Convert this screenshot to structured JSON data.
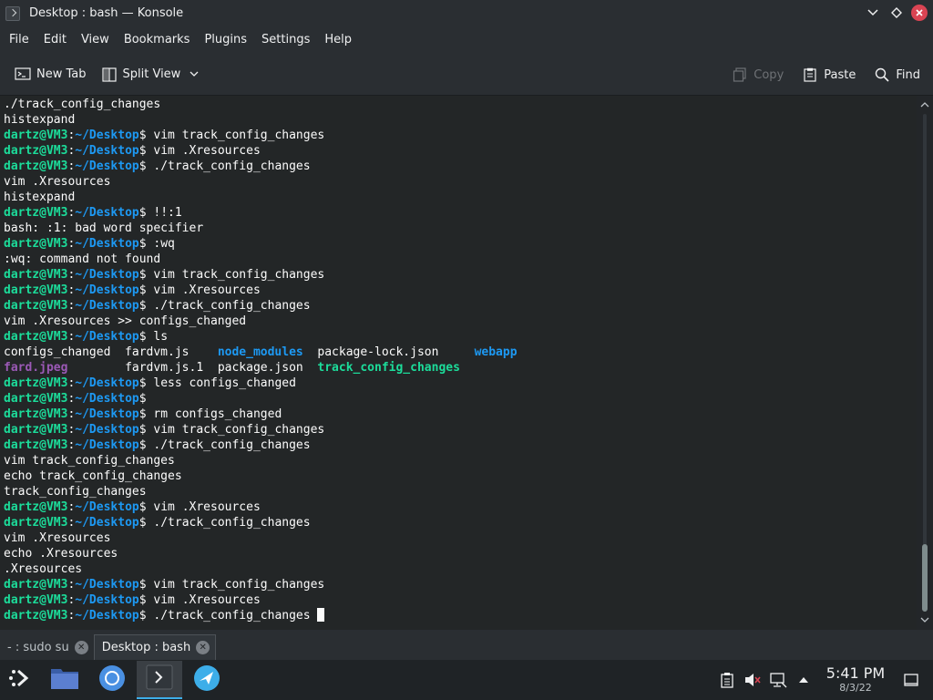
{
  "window": {
    "title": "Desktop : bash — Konsole"
  },
  "menubar": [
    "File",
    "Edit",
    "View",
    "Bookmarks",
    "Plugins",
    "Settings",
    "Help"
  ],
  "toolbar": {
    "new_tab": "New Tab",
    "split_view": "Split View",
    "copy": "Copy",
    "paste": "Paste",
    "find": "Find"
  },
  "terminal": {
    "lines": [
      [
        {
          "t": "./track_config_changes"
        }
      ],
      [
        {
          "t": "histexpand"
        }
      ],
      [
        {
          "t": "dartz@VM3",
          "c": "user"
        },
        {
          "t": ":"
        },
        {
          "t": "~/Desktop",
          "c": "path"
        },
        {
          "t": "$ vim track_config_changes"
        }
      ],
      [
        {
          "t": "dartz@VM3",
          "c": "user"
        },
        {
          "t": ":"
        },
        {
          "t": "~/Desktop",
          "c": "path"
        },
        {
          "t": "$ vim .Xresources"
        }
      ],
      [
        {
          "t": "dartz@VM3",
          "c": "user"
        },
        {
          "t": ":"
        },
        {
          "t": "~/Desktop",
          "c": "path"
        },
        {
          "t": "$ ./track_config_changes"
        }
      ],
      [
        {
          "t": "vim .Xresources"
        }
      ],
      [
        {
          "t": "histexpand"
        }
      ],
      [
        {
          "t": "dartz@VM3",
          "c": "user"
        },
        {
          "t": ":"
        },
        {
          "t": "~/Desktop",
          "c": "path"
        },
        {
          "t": "$ !!:1"
        }
      ],
      [
        {
          "t": "bash: :1: bad word specifier"
        }
      ],
      [
        {
          "t": "dartz@VM3",
          "c": "user"
        },
        {
          "t": ":"
        },
        {
          "t": "~/Desktop",
          "c": "path"
        },
        {
          "t": "$ :wq"
        }
      ],
      [
        {
          "t": ":wq: command not found"
        }
      ],
      [
        {
          "t": "dartz@VM3",
          "c": "user"
        },
        {
          "t": ":"
        },
        {
          "t": "~/Desktop",
          "c": "path"
        },
        {
          "t": "$ vim track_config_changes"
        }
      ],
      [
        {
          "t": "dartz@VM3",
          "c": "user"
        },
        {
          "t": ":"
        },
        {
          "t": "~/Desktop",
          "c": "path"
        },
        {
          "t": "$ vim .Xresources"
        }
      ],
      [
        {
          "t": "dartz@VM3",
          "c": "user"
        },
        {
          "t": ":"
        },
        {
          "t": "~/Desktop",
          "c": "path"
        },
        {
          "t": "$ ./track_config_changes"
        }
      ],
      [
        {
          "t": "vim .Xresources >> configs_changed"
        }
      ],
      [
        {
          "t": "dartz@VM3",
          "c": "user"
        },
        {
          "t": ":"
        },
        {
          "t": "~/Desktop",
          "c": "path"
        },
        {
          "t": "$ ls"
        }
      ],
      [
        {
          "t": "configs_changed  fardvm.js    "
        },
        {
          "t": "node_modules",
          "c": "c-dir"
        },
        {
          "t": "  package-lock.json     "
        },
        {
          "t": "webapp",
          "c": "c-dir"
        }
      ],
      [
        {
          "t": "fard.jpeg",
          "c": "c-img"
        },
        {
          "t": "        fardvm.js.1  package.json  "
        },
        {
          "t": "track_config_changes",
          "c": "c-exec"
        }
      ],
      [
        {
          "t": "dartz@VM3",
          "c": "user"
        },
        {
          "t": ":"
        },
        {
          "t": "~/Desktop",
          "c": "path"
        },
        {
          "t": "$ less configs_changed"
        }
      ],
      [
        {
          "t": "dartz@VM3",
          "c": "user"
        },
        {
          "t": ":"
        },
        {
          "t": "~/Desktop",
          "c": "path"
        },
        {
          "t": "$"
        }
      ],
      [
        {
          "t": "dartz@VM3",
          "c": "user"
        },
        {
          "t": ":"
        },
        {
          "t": "~/Desktop",
          "c": "path"
        },
        {
          "t": "$ rm configs_changed"
        }
      ],
      [
        {
          "t": "dartz@VM3",
          "c": "user"
        },
        {
          "t": ":"
        },
        {
          "t": "~/Desktop",
          "c": "path"
        },
        {
          "t": "$ vim track_config_changes"
        }
      ],
      [
        {
          "t": "dartz@VM3",
          "c": "user"
        },
        {
          "t": ":"
        },
        {
          "t": "~/Desktop",
          "c": "path"
        },
        {
          "t": "$ ./track_config_changes"
        }
      ],
      [
        {
          "t": "vim track_config_changes"
        }
      ],
      [
        {
          "t": "echo track_config_changes"
        }
      ],
      [
        {
          "t": "track_config_changes"
        }
      ],
      [
        {
          "t": "dartz@VM3",
          "c": "user"
        },
        {
          "t": ":"
        },
        {
          "t": "~/Desktop",
          "c": "path"
        },
        {
          "t": "$ vim .Xresources"
        }
      ],
      [
        {
          "t": "dartz@VM3",
          "c": "user"
        },
        {
          "t": ":"
        },
        {
          "t": "~/Desktop",
          "c": "path"
        },
        {
          "t": "$ ./track_config_changes"
        }
      ],
      [
        {
          "t": "vim .Xresources"
        }
      ],
      [
        {
          "t": "echo .Xresources"
        }
      ],
      [
        {
          "t": ".Xresources"
        }
      ],
      [
        {
          "t": "dartz@VM3",
          "c": "user"
        },
        {
          "t": ":"
        },
        {
          "t": "~/Desktop",
          "c": "path"
        },
        {
          "t": "$ vim track_config_changes"
        }
      ],
      [
        {
          "t": "dartz@VM3",
          "c": "user"
        },
        {
          "t": ":"
        },
        {
          "t": "~/Desktop",
          "c": "path"
        },
        {
          "t": "$ vim .Xresources"
        }
      ],
      [
        {
          "t": "dartz@VM3",
          "c": "user"
        },
        {
          "t": ":"
        },
        {
          "t": "~/Desktop",
          "c": "path"
        },
        {
          "t": "$ ./track_config_changes "
        }
      ]
    ]
  },
  "tabs": [
    {
      "label": "- : sudo su",
      "active": false
    },
    {
      "label": "Desktop : bash",
      "active": true
    }
  ],
  "taskbar": {
    "apps": [
      {
        "icon": "file-manager-icon",
        "active": false
      },
      {
        "icon": "chromium-icon",
        "active": false
      },
      {
        "icon": "konsole-icon",
        "active": true
      },
      {
        "icon": "discover-icon",
        "active": false
      }
    ],
    "clock_time": "5:41 PM",
    "clock_date": "8/3/22"
  },
  "colors": {
    "user": "#1cdc9a",
    "path": "#1d99f3",
    "dir": "#1d99f3",
    "image": "#9b59b6",
    "executable": "#1cdc9a",
    "accent": "#3daee9",
    "close": "#da4453"
  }
}
